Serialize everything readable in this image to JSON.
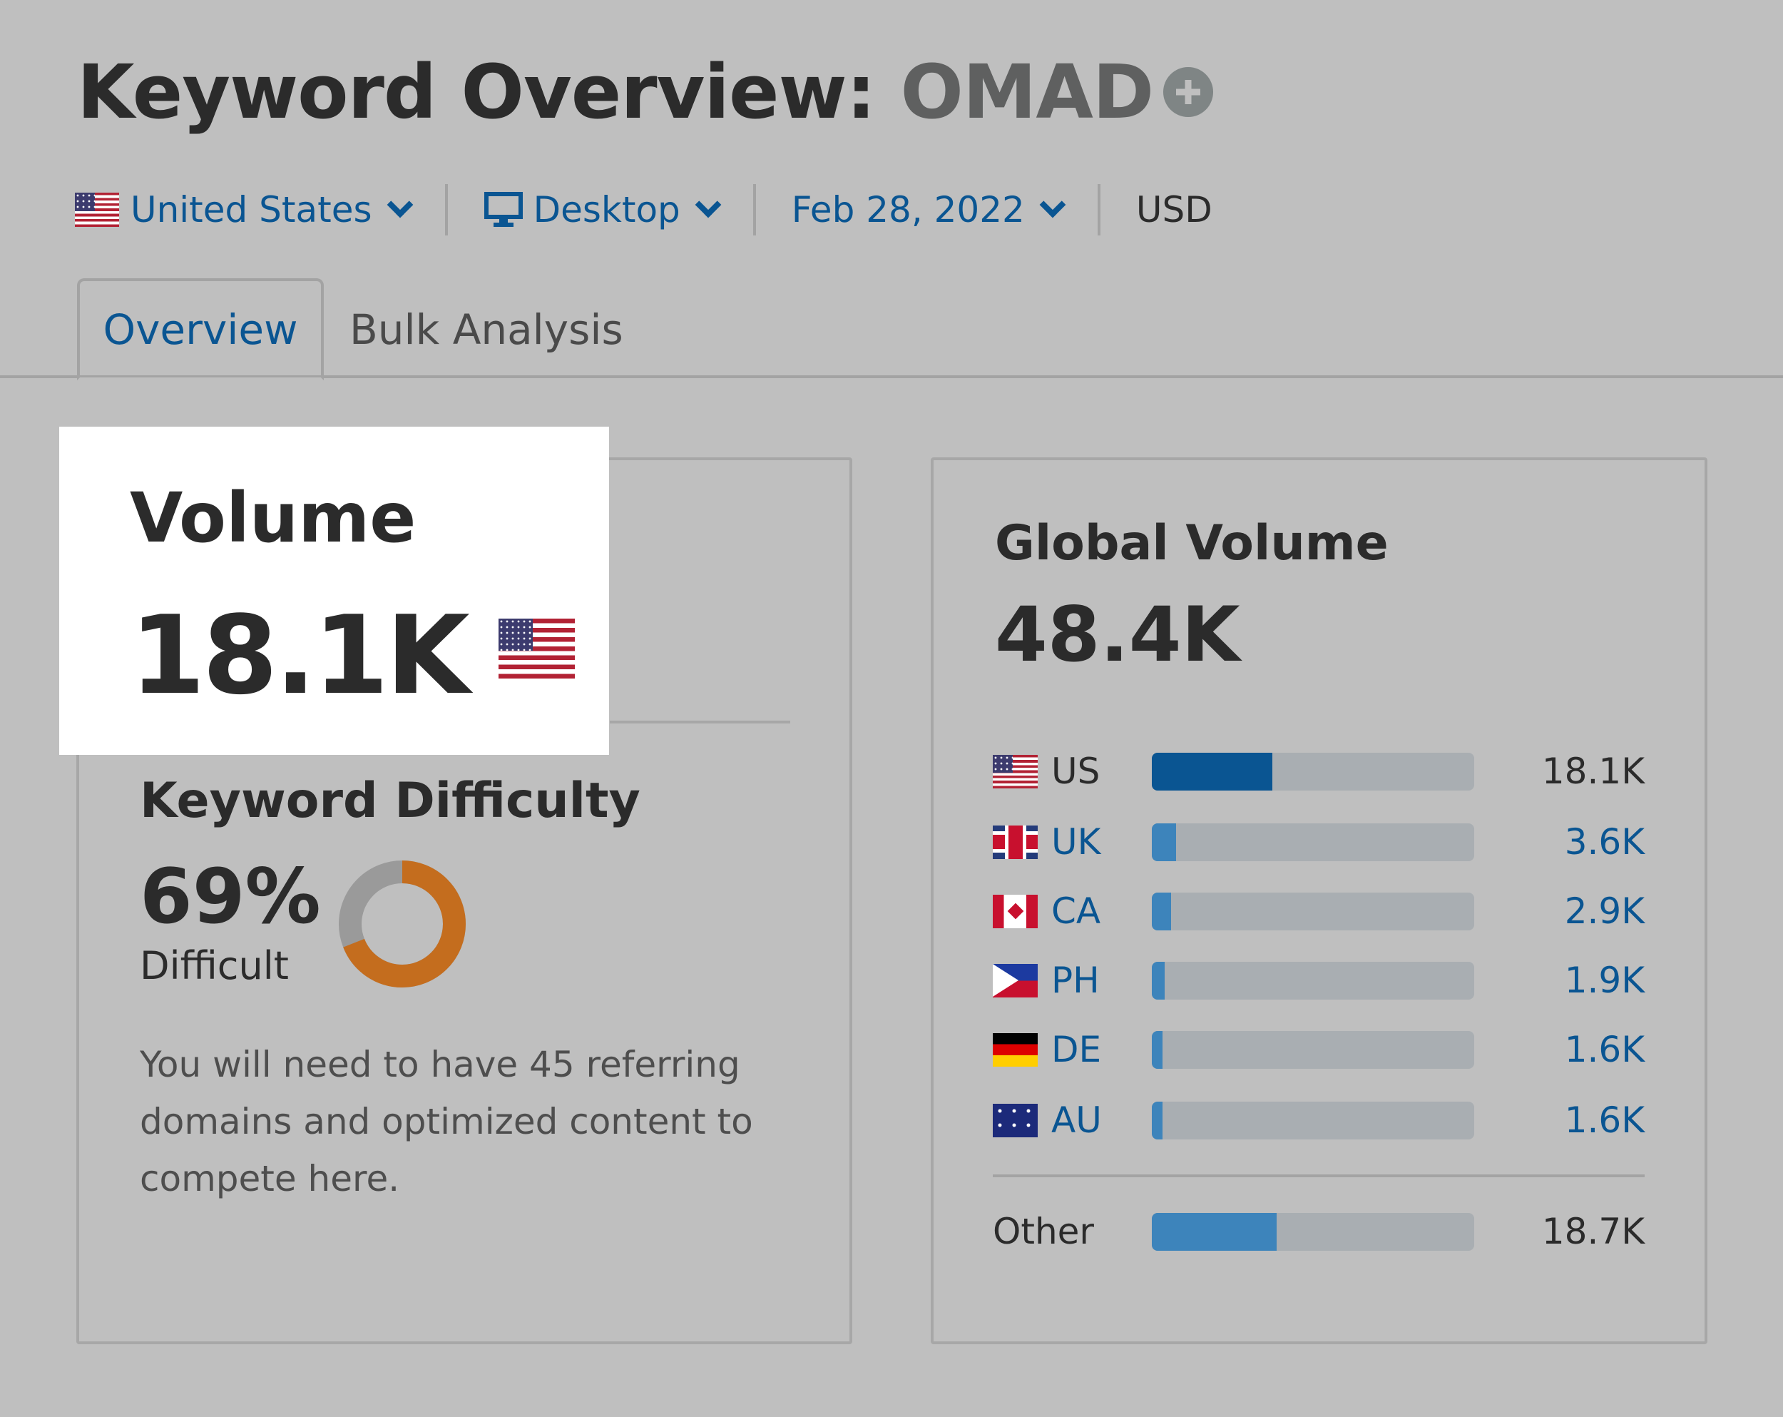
{
  "header": {
    "title_prefix": "Keyword Overview:",
    "keyword": "OMAD",
    "add_icon": "plus-circle-icon"
  },
  "filters": {
    "country": "United States",
    "device": "Desktop",
    "date": "Feb 28, 2022",
    "currency": "USD"
  },
  "tabs": [
    {
      "label": "Overview",
      "active": true
    },
    {
      "label": "Bulk Analysis",
      "active": false
    }
  ],
  "volume": {
    "label": "Volume",
    "value": "18.1K",
    "flag": "us-flag-icon"
  },
  "keyword_difficulty": {
    "label": "Keyword Difficulty",
    "value": "69%",
    "percent": 69,
    "level": "Difficult",
    "description": "You will need to have 45 referring domains and optimized content to compete here.",
    "colors": {
      "filled": "#c46d1e",
      "empty": "#9a9a9a"
    }
  },
  "global_volume": {
    "label": "Global Volume",
    "value": "48.4K",
    "total": 48.4,
    "countries": [
      {
        "code": "US",
        "value": "18.1K",
        "amount": 18.1,
        "flag": "us"
      },
      {
        "code": "UK",
        "value": "3.6K",
        "amount": 3.6,
        "flag": "uk"
      },
      {
        "code": "CA",
        "value": "2.9K",
        "amount": 2.9,
        "flag": "ca"
      },
      {
        "code": "PH",
        "value": "1.9K",
        "amount": 1.9,
        "flag": "ph"
      },
      {
        "code": "DE",
        "value": "1.6K",
        "amount": 1.6,
        "flag": "de"
      },
      {
        "code": "AU",
        "value": "1.6K",
        "amount": 1.6,
        "flag": "au"
      }
    ],
    "other": {
      "label": "Other",
      "value": "18.7K",
      "amount": 18.7
    },
    "colors": {
      "primary": "#0a5592",
      "secondary": "#3d84bb",
      "track": "#a9aeb2"
    }
  }
}
